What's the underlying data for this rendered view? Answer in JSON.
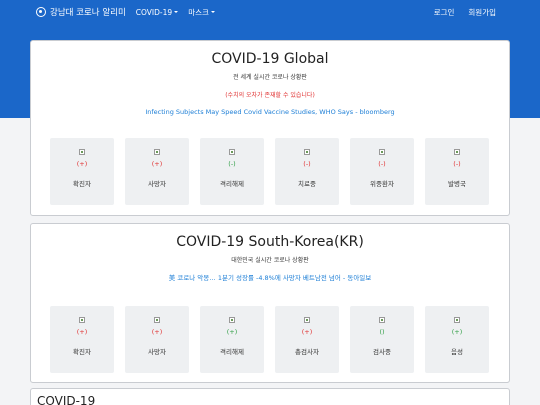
{
  "nav": {
    "brand": "강남대 코로나 알리미",
    "menu": [
      {
        "label": "COVID-19",
        "has_caret": true
      },
      {
        "label": "마스크",
        "has_caret": true
      }
    ],
    "right": [
      "로그인",
      "회원가입"
    ]
  },
  "global": {
    "title": "COVID-19 Global",
    "subtitle": "전 세계 실시간 코로나 상황판",
    "warning": "(수치의 오차가 존재할 수 있습니다)",
    "news": "Infecting Subjects May Speed Covid Vaccine Studies, WHO Says - bloomberg",
    "stats": [
      {
        "delta": "(+)",
        "label": "확진자",
        "tone": "red"
      },
      {
        "delta": "(+)",
        "label": "사망자",
        "tone": "red"
      },
      {
        "delta": "(-)",
        "label": "격리해제",
        "tone": "green"
      },
      {
        "delta": "(-)",
        "label": "치료중",
        "tone": "red"
      },
      {
        "delta": "(-)",
        "label": "위중환자",
        "tone": "red"
      },
      {
        "delta": "(-)",
        "label": "발병국",
        "tone": "red"
      }
    ]
  },
  "korea": {
    "title": "COVID-19 South-Korea(KR)",
    "subtitle": "대한민국 실시간 코로나 상황판",
    "news": "美 코로나 악몽… 1분기 성장률 -4.8%에 사망자 베트남전 넘어 - 동아일보",
    "stats": [
      {
        "delta": "(+)",
        "label": "확진자",
        "tone": "red"
      },
      {
        "delta": "(+)",
        "label": "사망자",
        "tone": "red"
      },
      {
        "delta": "(+)",
        "label": "격리해제",
        "tone": "green"
      },
      {
        "delta": "(+)",
        "label": "총검사자",
        "tone": "red"
      },
      {
        "delta": "()",
        "label": "검사중",
        "tone": "green"
      },
      {
        "delta": "(+)",
        "label": "음성",
        "tone": "green"
      }
    ]
  },
  "next": {
    "title": "COVID-19"
  },
  "colors": {
    "primary": "#1b67c9",
    "increase": "#e03131",
    "decrease": "#2f9e44",
    "link": "#1c7ed6"
  }
}
